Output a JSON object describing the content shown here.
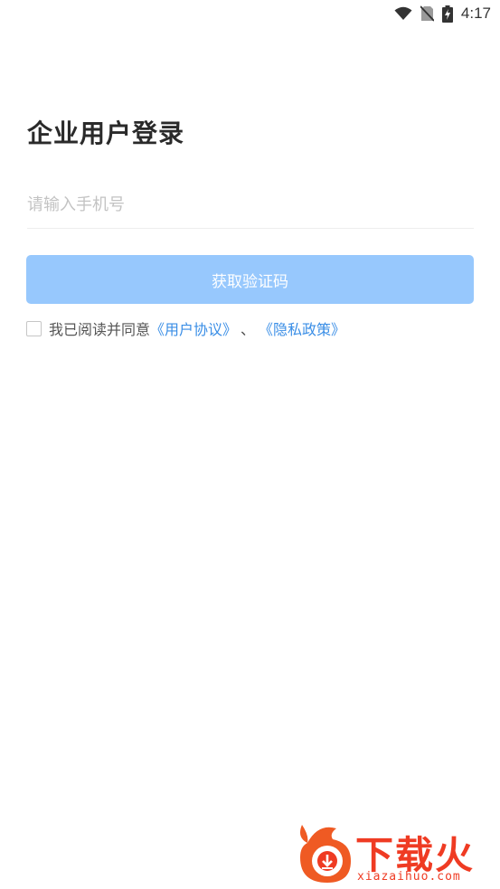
{
  "status_bar": {
    "time": "4:17",
    "icons": [
      "wifi-icon",
      "no-sim-icon",
      "battery-charging-icon"
    ]
  },
  "login": {
    "title": "企业用户登录",
    "phone_placeholder": "请输入手机号",
    "phone_value": "",
    "get_code_label": "获取验证码",
    "agreement_prefix": "我已阅读并同意",
    "user_agreement_link": "《用户协议》",
    "separator": "、",
    "privacy_policy_link": "《隐私政策》",
    "agreement_checked": false
  },
  "watermark": {
    "brand": "下载火",
    "domain": "xiazaihuo.com"
  },
  "colors": {
    "button_bg": "#97c8fd",
    "link": "#3a8ee6",
    "watermark": "#ef3b23"
  }
}
